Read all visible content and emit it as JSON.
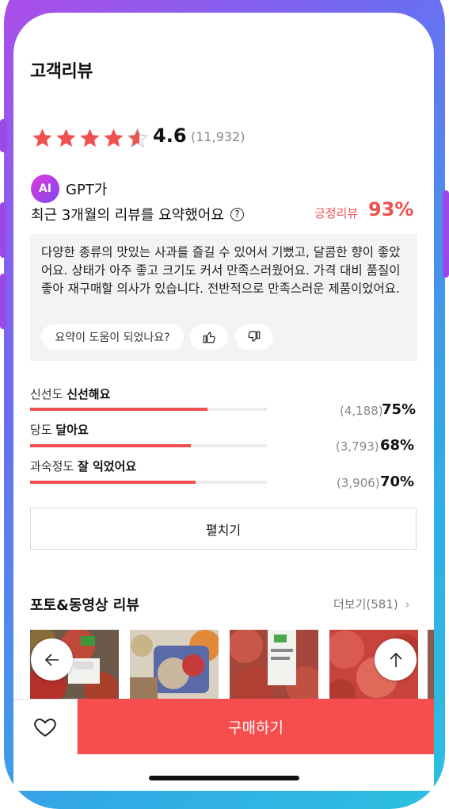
{
  "header": {
    "title": "고객리뷰"
  },
  "rating": {
    "stars": 4.6,
    "value": "4.6",
    "count": "(11,932)"
  },
  "ai_summary": {
    "badge": "AI",
    "source": "GPT가",
    "title": "최근 3개월의 리뷰를 요약했어요",
    "help_icon": "?",
    "positive_label": "긍정리뷰",
    "positive_value": "93%",
    "text": "다양한 종류의 맛있는 사과를 즐길 수 있어서 기뻤고, 달콤한 향이 좋았어요. 상태가 아주 좋고 크기도 커서 만족스러웠어요. 가격 대비 품질이 좋아 재구매할 의사가 있습니다. 전반적으로 만족스러운 제품이었어요.",
    "feedback_question": "요약이 도움이 되었나요?",
    "thumbs_up_icon": "thumbs-up-icon",
    "thumbs_down_icon": "thumbs-down-icon"
  },
  "attributes": [
    {
      "label": "신선도",
      "value": "신선해요",
      "count": "(4,188)",
      "percent": "75%",
      "fill": 0.75
    },
    {
      "label": "당도",
      "value": "달아요",
      "count": "(3,793)",
      "percent": "68%",
      "fill": 0.68
    },
    {
      "label": "과숙정도",
      "value": "잘 익었어요",
      "count": "(3,906)",
      "percent": "70%",
      "fill": 0.7
    }
  ],
  "expand_label": "펼치기",
  "photo_reviews": {
    "title": "포토&동영상 리뷰",
    "more_label": "더보기(581)"
  },
  "bottom": {
    "buy_label": "구매하기"
  },
  "colors": {
    "accent": "#f05050",
    "buy": "#f64e4e"
  }
}
